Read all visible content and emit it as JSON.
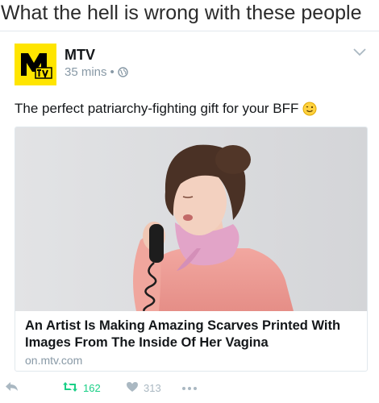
{
  "caption": "What the hell is wrong with these people",
  "tweet": {
    "account_name": "MTV",
    "time": "35 mins",
    "separator": "•",
    "text": "The perfect patriarchy-fighting gift for your BFF",
    "emoji": "winking-face",
    "logo_text": "M",
    "logo_sub": "TV"
  },
  "link_card": {
    "headline": "An Artist Is Making Amazing Scarves Printed With Images From The Inside Of Her Vagina",
    "domain": "on.mtv.com"
  },
  "actions": {
    "retweets": "162",
    "likes": "313"
  },
  "colors": {
    "brand_yellow": "#ffe500",
    "retweet_green": "#19cf86",
    "meta_gray": "#8899a6"
  }
}
